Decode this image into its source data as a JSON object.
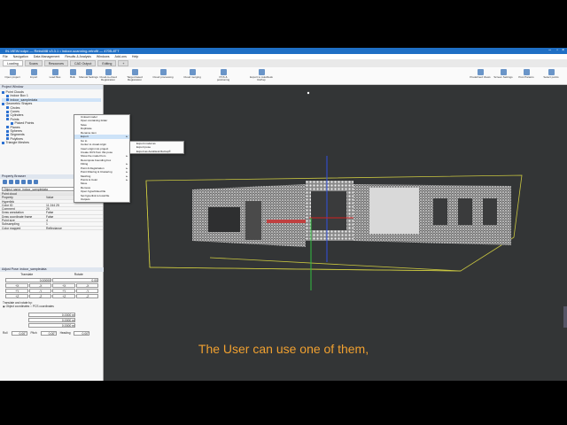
{
  "window": {
    "title": "IN-VIEW.rcdpx — RetroMill v3.3.1 • indoor-scanning-retrofit — 4705-8TT"
  },
  "menu": [
    "File",
    "Navigation",
    "Data Management",
    "Results & Analysis",
    "Windows",
    "Add-ons",
    "Help"
  ],
  "tabs": [
    "Loading",
    "Scans",
    "Resources",
    "CAD Output",
    "Editing"
  ],
  "ribbon": [
    "Open project",
    "Import",
    "Load files",
    "Bulk",
    "Manual Settings",
    "Cloud-to-cloud Registration",
    "Target-based Registration",
    "Cloud processing",
    "Cloud merging",
    "PCS & positioning",
    "Export to AutoDesk RePap",
    "Predefined Views",
    "Screen Settings",
    "Post Params",
    "Select points"
  ],
  "db_tree": {
    "header": "Project Window",
    "items": [
      {
        "label": "Point Clouds",
        "depth": 0,
        "checked": true
      },
      {
        "label": "Indoor Box 1",
        "depth": 1,
        "checked": true
      },
      {
        "label": "indoor_sampledata",
        "depth": 1,
        "checked": true,
        "selected": true
      },
      {
        "label": "Geometric Shapes",
        "depth": 0,
        "checked": true
      },
      {
        "label": "Circles",
        "depth": 1,
        "checked": true
      },
      {
        "label": "Cones",
        "depth": 1,
        "checked": true
      },
      {
        "label": "Cylinders",
        "depth": 1,
        "checked": true
      },
      {
        "label": "Points",
        "depth": 1,
        "checked": true
      },
      {
        "label": "Picked Points",
        "depth": 2,
        "checked": true
      },
      {
        "label": "Planes",
        "depth": 1,
        "checked": true
      },
      {
        "label": "Spheres",
        "depth": 1,
        "checked": true
      },
      {
        "label": "Segments",
        "depth": 1,
        "checked": true
      },
      {
        "label": "Polylines",
        "depth": 1,
        "checked": true
      },
      {
        "label": "Triangle Meshes",
        "depth": 0,
        "checked": true
      }
    ]
  },
  "properties": {
    "header": "Property Browser",
    "object_name": "Object name: indoor_sampledata",
    "section": "Point cloud",
    "col_property": "Property",
    "col_value": "Value",
    "rows": [
      {
        "k": "Hyperlink",
        "v": ""
      },
      {
        "k": "Color ID",
        "v": "11 244 25"
      },
      {
        "k": "Comment",
        "v": "25"
      },
      {
        "k": "Draw annotation",
        "v": "False"
      },
      {
        "k": "Draw coordinate frame",
        "v": "False"
      },
      {
        "k": "Point size",
        "v": "4"
      },
      {
        "k": "Subsampling",
        "v": "1"
      },
      {
        "k": "Color mapped",
        "v": "Reflectance"
      }
    ]
  },
  "adjust": {
    "header": "Adjust Pose: indoor_sampledata",
    "translate": "Translate",
    "rotate": "Rotate",
    "values": [
      "0.00000",
      "0.00",
      "+X",
      "-X",
      "+X",
      "-X",
      "+Y",
      "-Y",
      "+Y",
      "-Y",
      "+Z",
      "-Z",
      "+Z",
      "-Z"
    ],
    "mode_label": "Translate and rotate by:",
    "object_coords": "Object coordinates",
    "world_coords": "PCS coordinates",
    "roll_label": "Roll",
    "pitch_label": "Pitch",
    "heading_label": "Heading",
    "roll": "0.00°",
    "pitch": "0.00°",
    "heading": "0.00°",
    "pos_values": [
      "0.0000 m",
      "0.0000 m",
      "0.0000 m"
    ]
  },
  "context_menu": {
    "items": [
      "Unload model",
      "Open containing folder",
      "Save",
      "Duplicate",
      "Rename item",
      "Export",
      "Go to",
      "Center to visual origin",
      "Insert origin into project",
      "Create OCS from this pose",
      "Show the model from",
      "Recompute bounding box",
      "Fitting",
      "Point & Registration",
      "Point Filtering & Clustering",
      "Meshing",
      "Points & Color",
      "Move",
      "Remove",
      "Open hyperlinked file",
      "Set hyperlink to local file",
      "Outputs"
    ],
    "highlighted": "Export",
    "submenu": [
      "Export model as",
      "Export pose",
      "Export as AutoDesk ReCap®"
    ]
  },
  "subtitle": "The User can use one of them,"
}
